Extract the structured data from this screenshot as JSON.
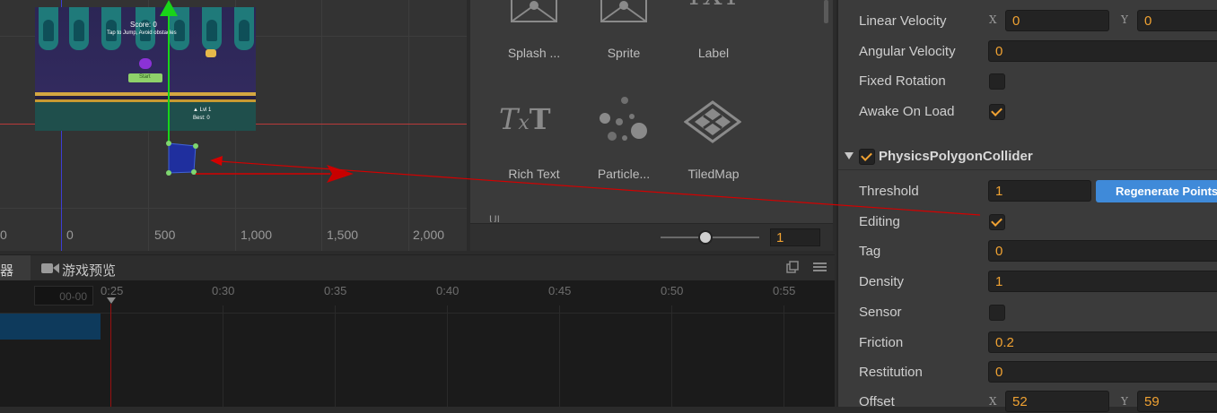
{
  "scene": {
    "ruler_ticks": [
      "0",
      "0",
      "500",
      "1,000",
      "1,500",
      "2,000"
    ],
    "game_preview": {
      "score_text": "Score: 0",
      "subtitle": "Tap to Jump, Avoid obstacles",
      "start_label": "Start",
      "info_line1": "▲ Lvl 1",
      "info_line2": "Best: 0"
    }
  },
  "assets": {
    "items": [
      {
        "label": "Splash ...",
        "icon": "splash-image-icon"
      },
      {
        "label": "Sprite",
        "icon": "sprite-image-icon"
      },
      {
        "label": "Label",
        "icon": "label-txt-icon"
      },
      {
        "label": "Rich Text",
        "icon": "rich-text-icon"
      },
      {
        "label": "Particle...",
        "icon": "particle-icon"
      },
      {
        "label": "TiledMap",
        "icon": "tiledmap-icon"
      }
    ],
    "partial_label": "UI",
    "zoom_value": "1"
  },
  "timeline": {
    "tabs": [
      {
        "label": "器"
      },
      {
        "label": "游戏预览",
        "icon": "camera-icon"
      }
    ],
    "time_field": "00-00",
    "marks": [
      "0:25",
      "0:30",
      "0:35",
      "0:40",
      "0:45",
      "0:50",
      "0:55"
    ]
  },
  "inspector": {
    "linear_velocity": {
      "label": "Linear Velocity",
      "x_label": "X",
      "x": "0",
      "y_label": "Y",
      "y": "0"
    },
    "angular_velocity": {
      "label": "Angular Velocity",
      "value": "0"
    },
    "fixed_rotation": {
      "label": "Fixed Rotation",
      "checked": false
    },
    "awake_on_load": {
      "label": "Awake On Load",
      "checked": true
    },
    "component_title": "PhysicsPolygonCollider",
    "threshold": {
      "label": "Threshold",
      "value": "1"
    },
    "regenerate_label": "Regenerate Points",
    "editing": {
      "label": "Editing",
      "checked": true
    },
    "tag": {
      "label": "Tag",
      "value": "0"
    },
    "density": {
      "label": "Density",
      "value": "1"
    },
    "sensor": {
      "label": "Sensor",
      "checked": false
    },
    "friction": {
      "label": "Friction",
      "value": "0.2"
    },
    "restitution": {
      "label": "Restitution",
      "value": "0"
    },
    "offset": {
      "label": "Offset",
      "x_label": "X",
      "x": "52",
      "y_label": "Y",
      "y": "59"
    }
  },
  "colors": {
    "accent": "#f0a232",
    "button_blue": "#3f8ad9",
    "annotation_red": "#d40000",
    "gizmo_green": "#19d419"
  }
}
